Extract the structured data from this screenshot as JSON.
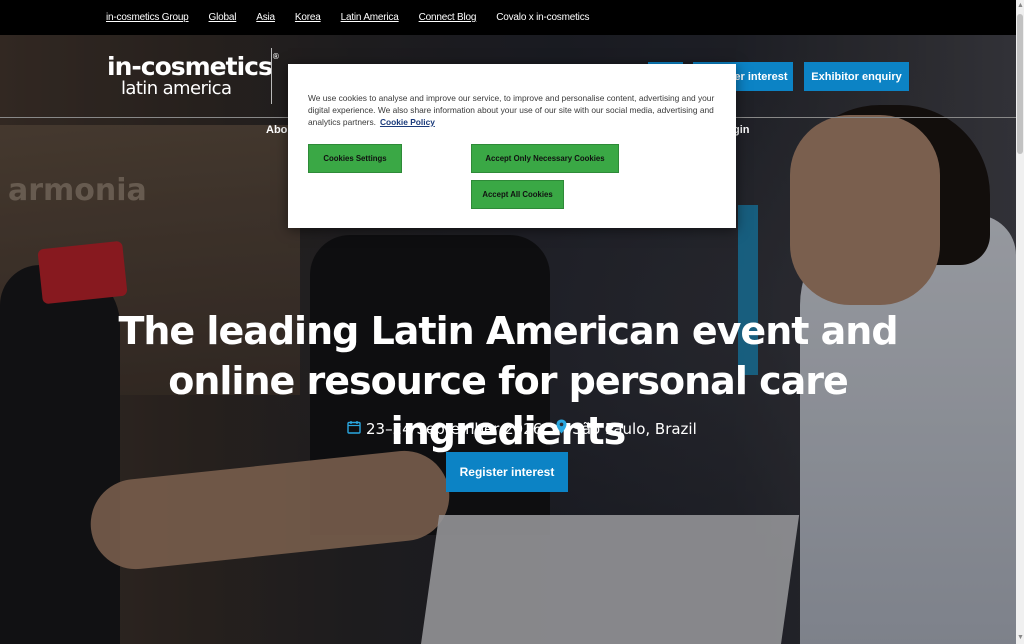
{
  "topbar": {
    "links": [
      "in-cosmetics Group",
      "Global",
      "Asia",
      "Korea",
      "Latin America",
      "Connect Blog",
      "Covalo x in-cosmetics"
    ]
  },
  "header": {
    "logo_line1": "in-cosmetics",
    "logo_reg": "®",
    "logo_line2": "latin america",
    "register_interest": "Register interest",
    "register_interest_partial": "er interest",
    "exhibitor_enquiry": "Exhibitor enquiry",
    "nav_about": "Abou",
    "nav_login": "gin"
  },
  "hero": {
    "background_text": "armonia",
    "headline": "The leading Latin American event and online resource for personal care ingredients",
    "date": "23–24 September 2026",
    "location": "São Paulo, Brazil",
    "cta": "Register interest"
  },
  "cookie": {
    "text": "We use cookies to analyse and improve our service, to improve and personalise content, advertising and your digital experience. We also share information about your use of our site with our social media, advertising and analytics partners.",
    "policy_link": "Cookie Policy",
    "settings_button": "Cookies Settings",
    "necessary_button": "Accept Only Necessary Cookies",
    "all_button": "Accept All Cookies"
  },
  "colors": {
    "brand_blue": "#0c83c5",
    "cookie_green": "#3aa845",
    "icon_blue": "#2aa7e0"
  }
}
